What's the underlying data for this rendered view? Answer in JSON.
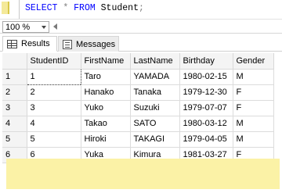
{
  "editor": {
    "keyword_select": "SELECT",
    "operator_star": "*",
    "keyword_from": "FROM",
    "table_name": "Student",
    "terminator": ";"
  },
  "zoom": {
    "value": "100 %"
  },
  "tabs": [
    {
      "label": "Results",
      "icon": "grid-icon"
    },
    {
      "label": "Messages",
      "icon": "messages-icon"
    }
  ],
  "results": {
    "columns": [
      "StudentID",
      "FirstName",
      "LastName",
      "Birthday",
      "Gender"
    ],
    "rows": [
      {
        "num": "1",
        "cells": [
          "1",
          "Taro",
          "YAMADA",
          "1980-02-15",
          "M"
        ]
      },
      {
        "num": "2",
        "cells": [
          "2",
          "Hanako",
          "Tanaka",
          "1979-12-30",
          "F"
        ]
      },
      {
        "num": "3",
        "cells": [
          "3",
          "Yuko",
          "Suzuki",
          "1979-07-07",
          "F"
        ]
      },
      {
        "num": "4",
        "cells": [
          "4",
          "Takao",
          "SATO",
          "1980-03-12",
          "M"
        ]
      },
      {
        "num": "5",
        "cells": [
          "5",
          "Hiroki",
          "TAKAGI",
          "1979-04-05",
          "M"
        ]
      },
      {
        "num": "6",
        "cells": [
          "6",
          "Yuka",
          "Kimura",
          "1981-03-27",
          "F"
        ]
      }
    ]
  },
  "colors": {
    "keyword": "#0000ff",
    "operator": "#808080",
    "gutter_marker": "#f4e99a",
    "empty_area": "#fbf2a6"
  }
}
